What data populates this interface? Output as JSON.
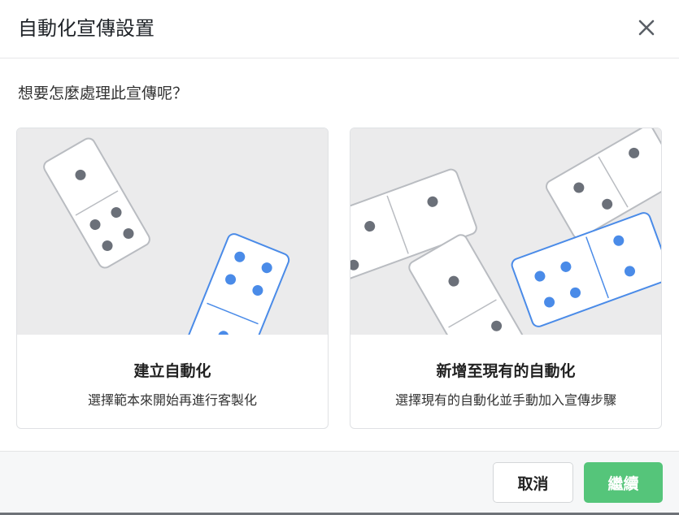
{
  "dialog": {
    "title": "自動化宣傳設置",
    "close_icon": "close-icon",
    "prompt": "想要怎麼處理此宣傳呢？"
  },
  "options": [
    {
      "title": "建立自動化",
      "description": "選擇範本來開始再進行客製化",
      "illustration_icon": "dominoes-icon"
    },
    {
      "title": "新增至現有的自動化",
      "description": "選擇現有的自動化並手動加入宣傳步驟",
      "illustration_icon": "dominoes-icon"
    }
  ],
  "footer": {
    "cancel_label": "取消",
    "continue_label": "繼續"
  },
  "colors": {
    "accent_green": "#55c57a",
    "highlight_blue": "#4a8be8",
    "pip_gray": "#6b7079",
    "illustration_bg": "#ebebec"
  }
}
